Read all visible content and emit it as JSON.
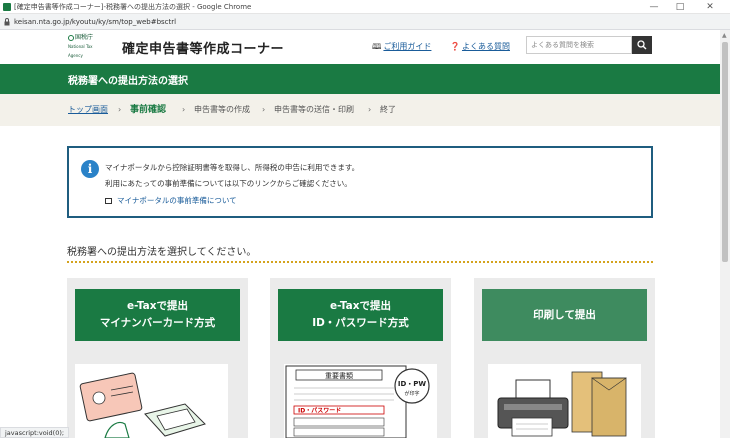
{
  "browser": {
    "title": "[確定申告書等作成コーナー]-税務署への提出方法の選択 - Google Chrome",
    "url": "keisan.nta.go.jp/kyoutu/ky/sm/top_web#bsctrl",
    "status_text": "javascript:void(0);"
  },
  "header": {
    "logo_line1": "国税庁",
    "logo_line2": "National Tax Agency",
    "site_title": "確定申告書等作成コーナー",
    "usage_guide_label": "ご利用ガイド",
    "faq_label": "よくある質問",
    "search_placeholder": "よくある質問を検索"
  },
  "banner": {
    "title": "税務署への提出方法の選択"
  },
  "breadcrumb": {
    "items": [
      {
        "label": "トップ画面"
      },
      {
        "label": "事前確認"
      },
      {
        "label": "申告書等の作成"
      },
      {
        "label": "申告書等の送信・印刷"
      },
      {
        "label": "終了"
      }
    ]
  },
  "notice": {
    "line1": "マイナポータルから控除証明書等を取得し、所得税の申告に利用できます。",
    "line2": "利用にあたっての事前準備については以下のリンクからご確認ください。",
    "link": "マイナポータルの事前準備について"
  },
  "main": {
    "section_heading": "税務署への提出方法を選択してください。"
  },
  "options": [
    {
      "line1": "e-Taxで提出",
      "line2": "マイナンバーカード方式",
      "color": "#1a7a43"
    },
    {
      "line1": "e-Taxで提出",
      "line2": "ID・パスワード方式",
      "color": "#1a7a43"
    },
    {
      "line1": "印刷して提出",
      "line2": "",
      "color": "#3e8b5f"
    }
  ],
  "illustration": {
    "doc_title": "重要書類",
    "id_pw_label": "ID・PW",
    "id_pw_sub": "が印字",
    "doc_strip": "ID・パスワード"
  },
  "colors": {
    "brand_green": "#1a7a43",
    "breadcrumb_bg": "#f3f1ea",
    "info_border": "#1f5d7f",
    "dotline": "#d4a31e"
  }
}
